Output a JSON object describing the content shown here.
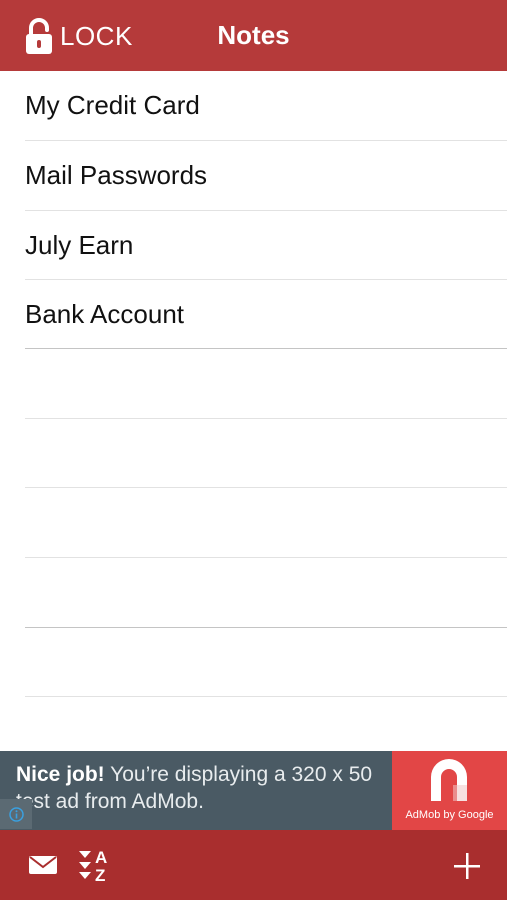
{
  "navbar": {
    "lock_label": "LOCK",
    "title": "Notes",
    "lock_icon": "lock-icon"
  },
  "notes": [
    {
      "title": "My Credit Card"
    },
    {
      "title": "Mail Passwords"
    },
    {
      "title": "July Earn"
    },
    {
      "title": "Bank Account"
    }
  ],
  "ad": {
    "headline": "Nice job!",
    "body": " You’re displaying a 320 x 50 test ad from AdMob.",
    "logo_caption": "AdMob by Google",
    "info_icon": "info-icon",
    "logo_icon": "admob-logo-icon"
  },
  "toolbar": {
    "mail_icon": "mail-icon",
    "sort_icon": "sort-az-icon",
    "add_icon": "plus-icon"
  },
  "colors": {
    "header_red": "#b53a3a",
    "toolbar_red": "#a92e2e",
    "ad_bg": "#4a5a64",
    "ad_logo_bg": "#e24646"
  }
}
